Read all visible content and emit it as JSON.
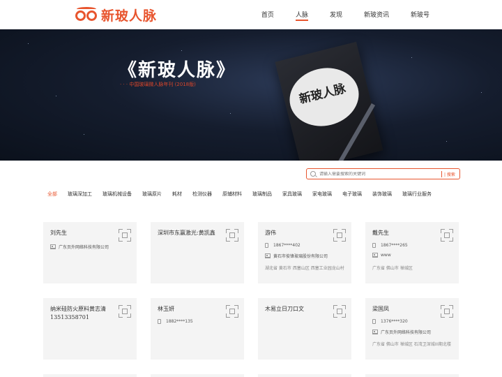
{
  "header": {
    "logo_text": "新玻人脉",
    "nav": [
      "首页",
      "人脉",
      "发现",
      "新玻资讯",
      "新玻号"
    ],
    "active_nav": 1
  },
  "banner": {
    "title": "《新玻人脉》",
    "subtitle": "· · ·  中国玻璃微人脉年刊 (2018版)",
    "book_text": "新玻人脉"
  },
  "search": {
    "placeholder": "请输入需要搜索的关键词",
    "button": "| 搜索"
  },
  "categories": [
    "全部",
    "玻璃深加工",
    "玻璃机械设备",
    "玻璃原片",
    "耗材",
    "检测仪器",
    "原辅材料",
    "玻璃制品",
    "家具玻璃",
    "家电玻璃",
    "电子玻璃",
    "装饰玻璃",
    "玻璃行业服务"
  ],
  "cards_row1": [
    {
      "name": "刘先生",
      "company": "广东页外网络科技有限公司"
    },
    {
      "name": "深圳市东赢激光:黄凯鑫"
    },
    {
      "name": "游伟",
      "phone": "1867****402",
      "company": "黄石市俊锋玻璃股份有限公司",
      "address": "湖北省  黄石市  西塞山区  西塞工业园龙山村"
    },
    {
      "name": "戴先生",
      "phone": "1867****265",
      "company": "www",
      "address": "广东省  佛山市  禅城区"
    }
  ],
  "cards_row2": [
    {
      "name": "纳米硅防火原料黄志清",
      "phone_big": "13513358701"
    },
    {
      "name": "林玉妍",
      "phone": "1882****135"
    },
    {
      "name": "木易立日刀口文"
    },
    {
      "name": "梁国凤",
      "phone": "1376****320",
      "company": "广东页外网络科技有限公司",
      "address": "广东省  佛山市  禅城区  石湾卫深城III期北楼"
    }
  ],
  "colors": {
    "accent": "#e8552e",
    "card_bg": "#f4f4f4",
    "banner_bg": "#151d2e"
  }
}
